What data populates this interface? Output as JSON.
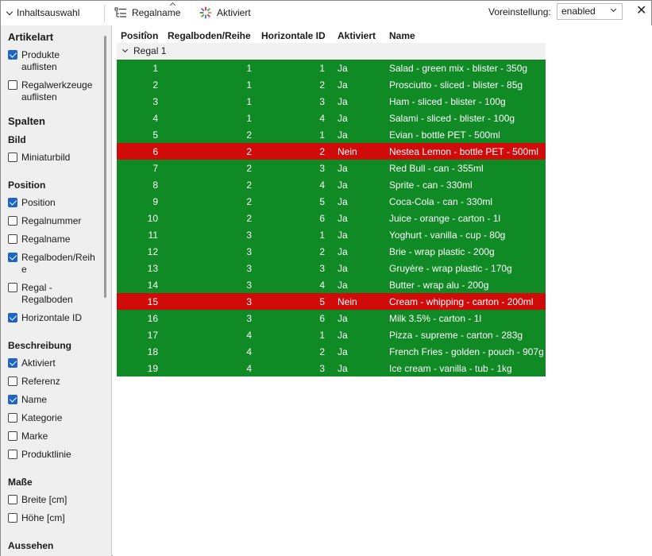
{
  "toolbar": {
    "content_selection": "Inhaltsauswahl",
    "regalname_btn": "Regalname",
    "aktiviert_btn": "Aktiviert",
    "voreinstellung_label": "Voreinstellung:",
    "voreinstellung_value": "enabled"
  },
  "sidebar": {
    "artikelart_heading": "Artikelart",
    "produkte": "Produkte auflisten",
    "regalwerkzeuge": "Regalwerkzeuge auflisten",
    "spalten_heading": "Spalten",
    "bild_heading": "Bild",
    "miniaturbild": "Miniaturbild",
    "position_heading": "Position",
    "position": "Position",
    "regalnummer": "Regalnummer",
    "regalname": "Regalname",
    "regalboden_reihe": "Regalboden/Reihe",
    "regal_regalboden": "Regal - Regalboden",
    "horizontale_id": "Horizontale ID",
    "beschreibung_heading": "Beschreibung",
    "aktiviert": "Aktiviert",
    "referenz": "Referenz",
    "name": "Name",
    "kategorie": "Kategorie",
    "marke": "Marke",
    "produktlinie": "Produktlinie",
    "masse_heading": "Maße",
    "breite": "Breite [cm]",
    "hoehe": "Höhe [cm]",
    "aussehen_heading": "Aussehen"
  },
  "table": {
    "headers": [
      "Position",
      "Regalboden/Reihe",
      "Horizontale ID",
      "Aktiviert",
      "Name"
    ],
    "group_label": "Regal 1",
    "rows": [
      {
        "pos": "1",
        "board": "1",
        "hid": "1",
        "akt": "Ja",
        "name": "Salad - green mix - blister - 350g"
      },
      {
        "pos": "2",
        "board": "1",
        "hid": "2",
        "akt": "Ja",
        "name": "Prosciutto - sliced - blister - 85g"
      },
      {
        "pos": "3",
        "board": "1",
        "hid": "3",
        "akt": "Ja",
        "name": "Ham - sliced - blister - 100g"
      },
      {
        "pos": "4",
        "board": "1",
        "hid": "4",
        "akt": "Ja",
        "name": "Salami - sliced - blister - 100g"
      },
      {
        "pos": "5",
        "board": "2",
        "hid": "1",
        "akt": "Ja",
        "name": "Evian - bottle PET - 500ml"
      },
      {
        "pos": "6",
        "board": "2",
        "hid": "2",
        "akt": "Nein",
        "name": "Nestea Lemon - bottle PET - 500ml"
      },
      {
        "pos": "7",
        "board": "2",
        "hid": "3",
        "akt": "Ja",
        "name": "Red Bull - can - 355ml"
      },
      {
        "pos": "8",
        "board": "2",
        "hid": "4",
        "akt": "Ja",
        "name": "Sprite - can - 330ml"
      },
      {
        "pos": "9",
        "board": "2",
        "hid": "5",
        "akt": "Ja",
        "name": "Coca-Cola - can - 330ml"
      },
      {
        "pos": "10",
        "board": "2",
        "hid": "6",
        "akt": "Ja",
        "name": "Juice - orange - carton - 1l"
      },
      {
        "pos": "11",
        "board": "3",
        "hid": "1",
        "akt": "Ja",
        "name": "Yoghurt - vanilla - cup - 80g"
      },
      {
        "pos": "12",
        "board": "3",
        "hid": "2",
        "akt": "Ja",
        "name": "Brie - wrap plastic - 200g"
      },
      {
        "pos": "13",
        "board": "3",
        "hid": "3",
        "akt": "Ja",
        "name": "Gruyère - wrap plastic - 170g"
      },
      {
        "pos": "14",
        "board": "3",
        "hid": "4",
        "akt": "Ja",
        "name": "Butter - wrap alu - 200g"
      },
      {
        "pos": "15",
        "board": "3",
        "hid": "5",
        "akt": "Nein",
        "name": "Cream - whipping - carton - 200ml"
      },
      {
        "pos": "16",
        "board": "3",
        "hid": "6",
        "akt": "Ja",
        "name": "Milk 3.5% - carton - 1l"
      },
      {
        "pos": "17",
        "board": "4",
        "hid": "1",
        "akt": "Ja",
        "name": "Pizza - supreme - carton - 283g"
      },
      {
        "pos": "18",
        "board": "4",
        "hid": "2",
        "akt": "Ja",
        "name": "French Fries - golden - pouch - 907g"
      },
      {
        "pos": "19",
        "board": "4",
        "hid": "3",
        "akt": "Ja",
        "name": "Ice cream - vanilla - tub - 1kg"
      }
    ]
  },
  "colors": {
    "active_row": "#0f8a24",
    "inactive_row": "#d10a0a",
    "checkbox_on": "#1d64c4"
  }
}
